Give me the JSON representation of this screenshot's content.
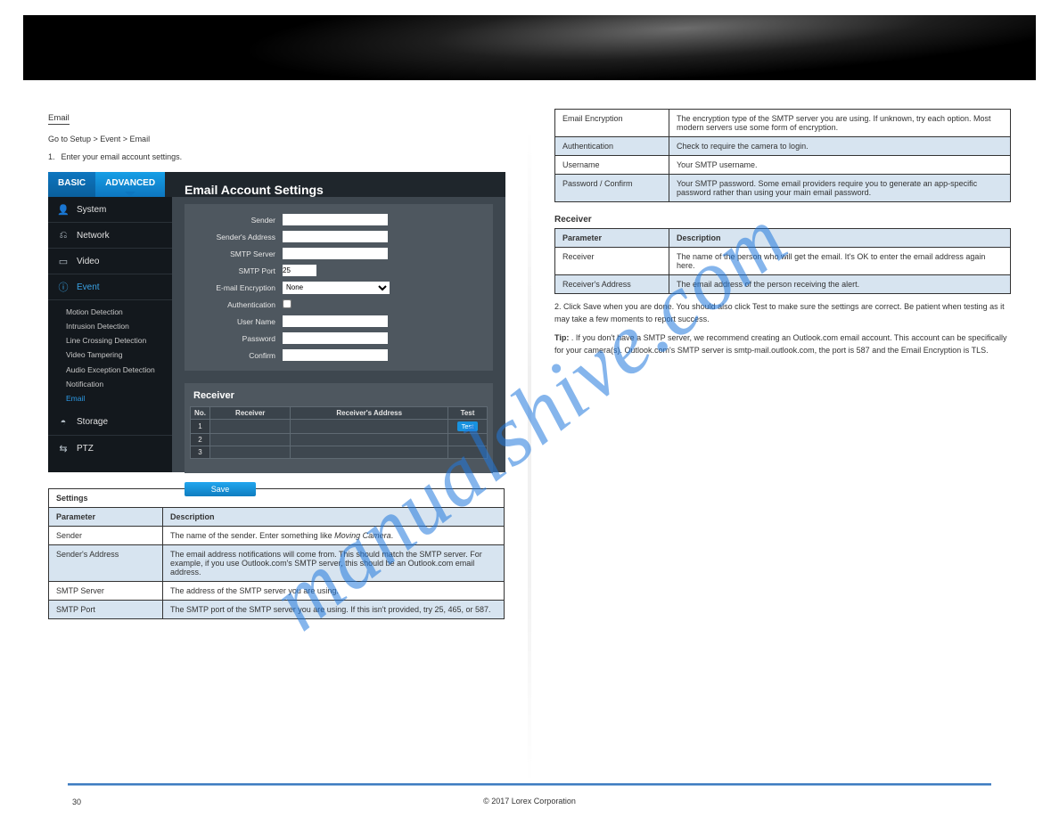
{
  "banner": {},
  "left": {
    "section_heading": "Email",
    "intro_line": "Go to Setup > Event > Email",
    "step_num": "1.",
    "step_text": "Enter your email account settings.",
    "ui": {
      "tabs": {
        "basic": "BASIC",
        "advanced": "ADVANCED"
      },
      "sidebar": {
        "system": "System",
        "network": "Network",
        "video": "Video",
        "event": "Event",
        "storage": "Storage",
        "ptz": "PTZ",
        "event_children": {
          "motion": "Motion Detection",
          "intrusion": "Intrusion Detection",
          "line": "Line Crossing Detection",
          "tamper": "Video Tampering",
          "audio": "Audio Exception Detection",
          "notif": "Notification",
          "email": "Email"
        }
      },
      "title": "Email Account Settings",
      "form": {
        "sender": "Sender",
        "sender_addr": "Sender's Address",
        "smtp_server": "SMTP Server",
        "smtp_port": "SMTP Port",
        "smtp_port_val": "25",
        "encryption": "E-mail Encryption",
        "encryption_val": "None",
        "auth": "Authentication",
        "username": "User Name",
        "password": "Password",
        "confirm": "Confirm"
      },
      "receiver_title": "Receiver",
      "receiver_headers": {
        "no": "No.",
        "rcv": "Receiver",
        "addr": "Receiver's Address",
        "test": "Test"
      },
      "receiver_rows": [
        "1",
        "2",
        "3"
      ],
      "test_btn": "Test",
      "save_btn": "Save"
    },
    "table": {
      "title": "Settings",
      "hdr_param": "Parameter",
      "hdr_desc": "Description",
      "rows": [
        {
          "p": "Sender",
          "d_html": "The name of the sender. Enter something like <span class='i'>Moving Camera</span>."
        },
        {
          "p": "Sender's Address",
          "d_html": "The email address notifications will come from. This should match the SMTP server. For example, if you use Outlook.com's SMTP server, this should be an Outlook.com email address."
        },
        {
          "p": "SMTP Server",
          "d_html": "The address of the SMTP server you are using."
        },
        {
          "p": "SMTP Port",
          "d_html": "The SMTP port of the SMTP server you are using. If this isn't provided, try 25, 465, or 587."
        }
      ]
    }
  },
  "right": {
    "table_cont": {
      "rows": [
        {
          "p": "Email Encryption",
          "d_html": "The encryption type of the SMTP server you are using. If unknown, try each option. Most modern servers use some form of encryption."
        },
        {
          "p": "Authentication",
          "d_html": "Check to require the camera to login."
        },
        {
          "p": "Username",
          "d_html": "Your SMTP username."
        },
        {
          "p": "Password / Confirm",
          "d_html": "Your SMTP password. Some email providers require you to generate an app-specific password rather than using your main email password."
        }
      ]
    },
    "receiver_heading": "Receiver",
    "receiver_table": {
      "hdr_param": "Parameter",
      "hdr_desc": "Description",
      "rows": [
        {
          "p": "Receiver",
          "d_html": "The name of the person who will get the email. It's OK to enter the email address again here."
        },
        {
          "p": "Receiver's Address",
          "d_html": "The email address of the person receiving the alert."
        }
      ]
    },
    "step2_num": "2.",
    "step2_text": "Click Save when you are done. You should also click Test to make sure the settings are correct. Be patient when testing as it may take a few moments to report success.",
    "tip_html": "<b>Tip:</b> . If you don't have a SMTP server, we recommend creating an Outlook.com email account. This account can be specifically for your camera(s). Outlook.com's SMTP server is <span class='i'>smtp-mail.outlook.com</span>, the port is <span class='i'>587</span> and the Email Encryption is <span class='i'>TLS</span>."
  },
  "footer": {
    "page_num": "30",
    "copyright": "© 2017 Lorex Corporation"
  },
  "watermark": "manualshive.com"
}
